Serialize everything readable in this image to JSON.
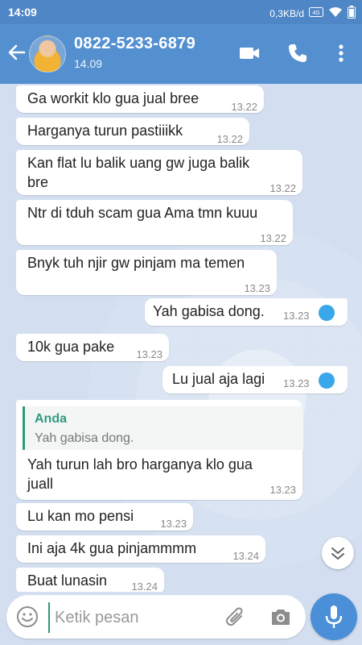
{
  "status_bar": {
    "time": "14:09",
    "speed": "0,3KB/d",
    "network": "4G"
  },
  "header": {
    "contact_name": "0822-5233-6879",
    "subtitle": "14.09",
    "icons": [
      "back-arrow-icon",
      "video-call-icon",
      "phone-icon",
      "more-vertical-icon"
    ]
  },
  "messages": [
    {
      "direction": "in",
      "text": "Ga workit klo gua jual bree",
      "time": "13.22"
    },
    {
      "direction": "in",
      "text": "Harganya turun pastiiikk",
      "time": "13.22"
    },
    {
      "direction": "in",
      "lines": [
        "Kan flat lu balik uang gw juga balik",
        "bre"
      ],
      "time": "13.22"
    },
    {
      "direction": "in",
      "text": "Ntr di tduh scam gua Ama tmn kuuu",
      "time": "13.22"
    },
    {
      "direction": "in",
      "text": "Bnyk tuh njir gw pinjam ma temen",
      "time": "13.23"
    },
    {
      "direction": "out",
      "text": "Yah gabisa dong.",
      "time": "13.23"
    },
    {
      "direction": "in",
      "text": "10k gua pake",
      "time": "13.23"
    },
    {
      "direction": "out",
      "text": "Lu jual aja lagi",
      "time": "13.23"
    },
    {
      "direction": "in",
      "quote_name": "Anda",
      "quote_text": "Yah gabisa dong.",
      "lines": [
        "Yah turun lah bro harganya klo gua",
        "juall"
      ],
      "time": "13.23"
    },
    {
      "direction": "in",
      "text": "Lu kan mo pensi",
      "time": "13.23"
    },
    {
      "direction": "in",
      "text": "Ini aja 4k gua pinjammmm",
      "time": "13.24"
    },
    {
      "direction": "in",
      "text": "Buat lunasin",
      "time": "13.24"
    }
  ],
  "composer": {
    "placeholder": "Ketik pesan",
    "icons": [
      "emoji-icon",
      "attachment-icon",
      "camera-icon",
      "microphone-icon"
    ]
  },
  "colors": {
    "header": "#5490d0",
    "status_bar": "#4f86c6",
    "chat_background": "#d3dff0",
    "read_tick": "#3aa7ea",
    "quote_accent": "#2f9a7b"
  }
}
